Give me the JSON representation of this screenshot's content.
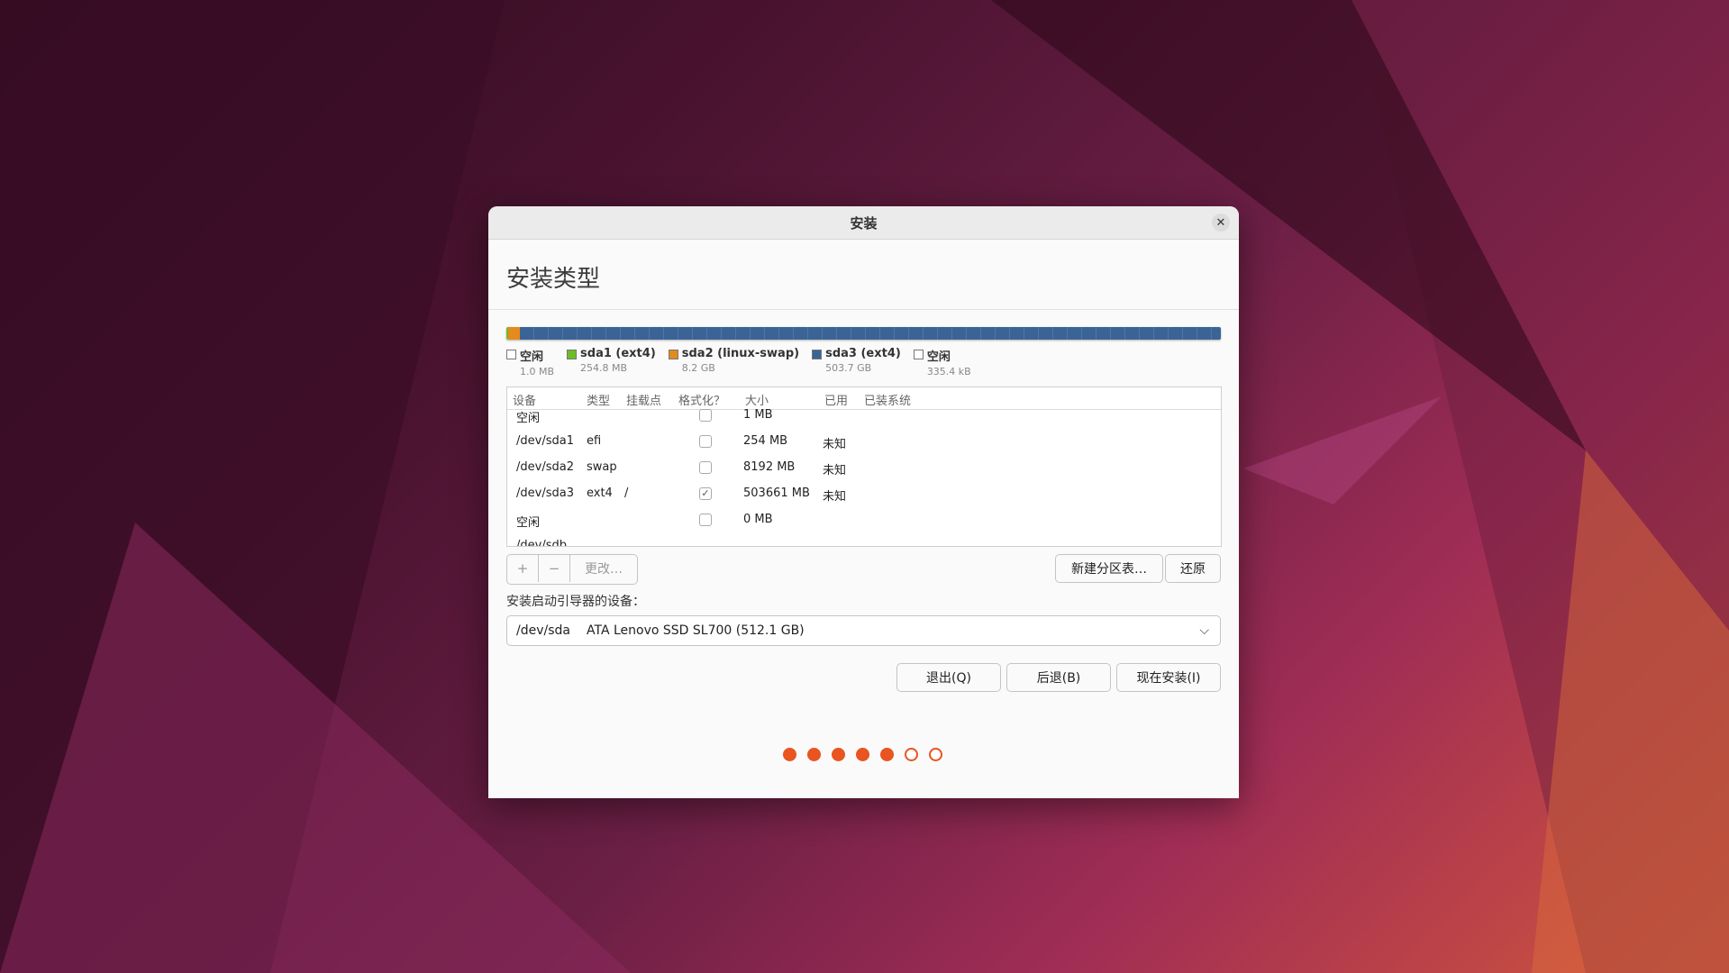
{
  "window": {
    "title": "安装",
    "close_glyph": "✕"
  },
  "page": {
    "heading": "安装类型"
  },
  "partition_bar": [
    {
      "label": "空闲",
      "size": "1.0 MB",
      "color": "#ffffff",
      "fraction": 2e-06
    },
    {
      "label": "sda1 (ext4)",
      "size": "254.8 MB",
      "color": "#6dbd27",
      "fraction": 0.0005
    },
    {
      "label": "sda2 (linux-swap)",
      "size": "8.2 GB",
      "color": "#e58a1c",
      "fraction": 0.016
    },
    {
      "label": "sda3 (ext4)",
      "size": "503.7 GB",
      "color": "#3b6496",
      "fraction": 0.983
    },
    {
      "label": "空闲",
      "size": "335.4 kB",
      "color": "#ffffff",
      "fraction": 7e-07
    }
  ],
  "table": {
    "headers": {
      "device": "设备",
      "type": "类型",
      "mount": "挂载点",
      "format": "格式化？",
      "size": "大小",
      "used": "已用",
      "system": "已装系统"
    },
    "rows": [
      {
        "device": "空闲",
        "type": "",
        "mount": "",
        "format": false,
        "size": "1 MB",
        "used": ""
      },
      {
        "device": "/dev/sda1",
        "type": "efi",
        "mount": "",
        "format": false,
        "size": "254 MB",
        "used": "未知"
      },
      {
        "device": "/dev/sda2",
        "type": "swap",
        "mount": "",
        "format": false,
        "size": "8192 MB",
        "used": "未知"
      },
      {
        "device": "/dev/sda3",
        "type": "ext4",
        "mount": "/",
        "format": true,
        "size": "503661 MB",
        "used": "未知"
      },
      {
        "device": "空闲",
        "type": "",
        "mount": "",
        "format": false,
        "size": "0 MB",
        "used": ""
      },
      {
        "device": "/dev/sdb",
        "type": "",
        "mount": "",
        "format": false,
        "size": "",
        "used": ""
      }
    ]
  },
  "toolbar": {
    "add": "+",
    "remove": "−",
    "change": "更改…",
    "new_table": "新建分区表…",
    "revert": "还原"
  },
  "boot": {
    "label": "安装启动引导器的设备：",
    "device": "/dev/sda",
    "description": "ATA Lenovo SSD SL700 (512.1 GB)",
    "chevron": "⌵"
  },
  "actions": {
    "quit": "退出(Q)",
    "back": "后退(B)",
    "install": "现在安装(I)"
  },
  "progress": {
    "total_steps": 7,
    "completed_steps": 5
  },
  "colors": {
    "accent": "#e95420"
  }
}
